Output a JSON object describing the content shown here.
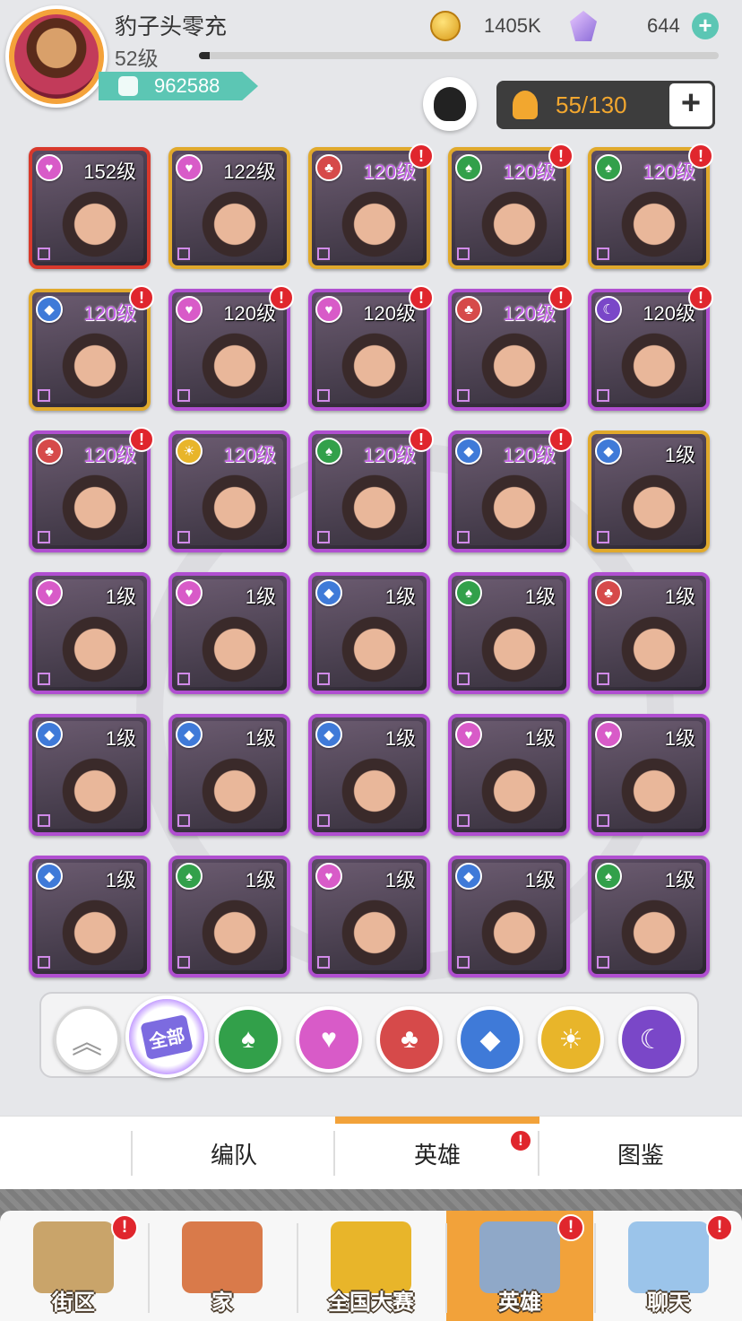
{
  "player": {
    "name": "豹子头零充",
    "level": "52级",
    "power": "962588",
    "exp_fraction": 0.02
  },
  "currency": {
    "coins": "1405K",
    "gems": "644"
  },
  "roster": {
    "count": "55/130"
  },
  "heroes": [
    {
      "level": "152级",
      "faction": "heart",
      "frame": "red",
      "alert": false,
      "purple_level": false
    },
    {
      "level": "122级",
      "faction": "heart",
      "frame": "gold",
      "alert": false,
      "purple_level": false
    },
    {
      "level": "120级",
      "faction": "club",
      "frame": "gold",
      "alert": true,
      "purple_level": true
    },
    {
      "level": "120级",
      "faction": "spade",
      "frame": "gold",
      "alert": true,
      "purple_level": true
    },
    {
      "level": "120级",
      "faction": "spade",
      "frame": "gold",
      "alert": true,
      "purple_level": true
    },
    {
      "level": "120级",
      "faction": "diamond",
      "frame": "gold",
      "alert": true,
      "purple_level": true
    },
    {
      "level": "120级",
      "faction": "heart",
      "frame": "purple",
      "alert": true,
      "purple_level": false
    },
    {
      "level": "120级",
      "faction": "heart",
      "frame": "purple",
      "alert": true,
      "purple_level": false
    },
    {
      "level": "120级",
      "faction": "club",
      "frame": "purple",
      "alert": true,
      "purple_level": true
    },
    {
      "level": "120级",
      "faction": "moon",
      "frame": "purple",
      "alert": true,
      "purple_level": false
    },
    {
      "level": "120级",
      "faction": "club",
      "frame": "purple",
      "alert": true,
      "purple_level": true
    },
    {
      "level": "120级",
      "faction": "sun",
      "frame": "purple",
      "alert": false,
      "purple_level": true
    },
    {
      "level": "120级",
      "faction": "spade",
      "frame": "purple",
      "alert": true,
      "purple_level": true
    },
    {
      "level": "120级",
      "faction": "diamond",
      "frame": "purple",
      "alert": true,
      "purple_level": true
    },
    {
      "level": "1级",
      "faction": "diamond",
      "frame": "gold",
      "alert": false,
      "purple_level": false
    },
    {
      "level": "1级",
      "faction": "heart",
      "frame": "purple",
      "alert": false,
      "purple_level": false
    },
    {
      "level": "1级",
      "faction": "heart",
      "frame": "purple",
      "alert": false,
      "purple_level": false
    },
    {
      "level": "1级",
      "faction": "diamond",
      "frame": "purple",
      "alert": false,
      "purple_level": false
    },
    {
      "level": "1级",
      "faction": "spade",
      "frame": "purple",
      "alert": false,
      "purple_level": false
    },
    {
      "level": "1级",
      "faction": "club",
      "frame": "purple",
      "alert": false,
      "purple_level": false
    },
    {
      "level": "1级",
      "faction": "diamond",
      "frame": "purple",
      "alert": false,
      "purple_level": false
    },
    {
      "level": "1级",
      "faction": "diamond",
      "frame": "purple",
      "alert": false,
      "purple_level": false
    },
    {
      "level": "1级",
      "faction": "diamond",
      "frame": "purple",
      "alert": false,
      "purple_level": false
    },
    {
      "level": "1级",
      "faction": "heart",
      "frame": "purple",
      "alert": false,
      "purple_level": false
    },
    {
      "level": "1级",
      "faction": "heart",
      "frame": "purple",
      "alert": false,
      "purple_level": false
    },
    {
      "level": "1级",
      "faction": "diamond",
      "frame": "purple",
      "alert": false,
      "purple_level": false
    },
    {
      "level": "1级",
      "faction": "spade",
      "frame": "purple",
      "alert": false,
      "purple_level": false
    },
    {
      "level": "1级",
      "faction": "heart",
      "frame": "purple",
      "alert": false,
      "purple_level": false
    },
    {
      "level": "1级",
      "faction": "diamond",
      "frame": "purple",
      "alert": false,
      "purple_level": false
    },
    {
      "level": "1级",
      "faction": "spade",
      "frame": "purple",
      "alert": false,
      "purple_level": false
    }
  ],
  "filters": {
    "all_label": "全部",
    "factions": [
      "spade",
      "heart",
      "club",
      "diamond",
      "sun",
      "moon"
    ]
  },
  "subtabs": [
    {
      "label": "",
      "active": false,
      "alert": false
    },
    {
      "label": "编队",
      "active": false,
      "alert": false
    },
    {
      "label": "英雄",
      "active": true,
      "alert": true
    },
    {
      "label": "图鉴",
      "active": false,
      "alert": false
    }
  ],
  "nav": [
    {
      "label": "街区",
      "icon": "signpost-icon",
      "active": false,
      "alert": true
    },
    {
      "label": "家",
      "icon": "house-icon",
      "active": false,
      "alert": false
    },
    {
      "label": "全国大赛",
      "icon": "trophy-icon",
      "active": false,
      "alert": false
    },
    {
      "label": "英雄",
      "icon": "hero-cards-icon",
      "active": true,
      "alert": true
    },
    {
      "label": "聊天",
      "icon": "chat-bubble-icon",
      "active": false,
      "alert": true
    }
  ],
  "alert_mark": "!",
  "colors": {
    "accent_orange": "#f2a23a",
    "teal": "#5cc6b4",
    "frame_purple": "#b04fd0",
    "frame_gold": "#e0a92c",
    "frame_red": "#d8392c",
    "alert_red": "#e0262d"
  }
}
